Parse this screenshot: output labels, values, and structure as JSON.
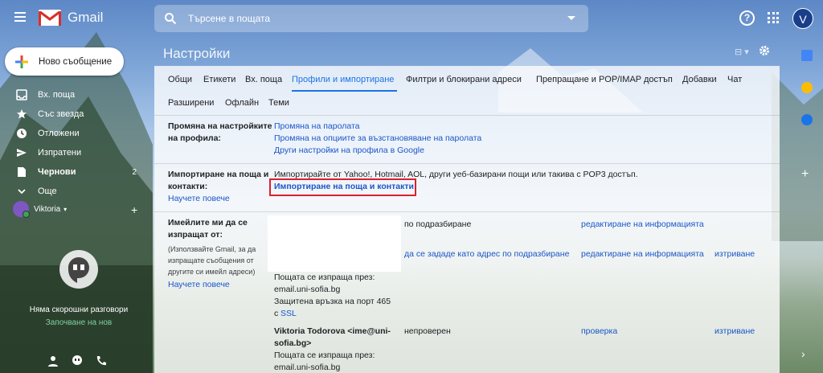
{
  "app": {
    "name": "Gmail",
    "user_initial": "V"
  },
  "search": {
    "placeholder": "Търсене в пощата"
  },
  "compose": {
    "label": "Ново съобщение"
  },
  "nav": [
    {
      "label": "Вх. поща",
      "icon": "inbox-icon",
      "bold": false,
      "count": ""
    },
    {
      "label": "Със звезда",
      "icon": "star-icon",
      "bold": false,
      "count": ""
    },
    {
      "label": "Отложени",
      "icon": "clock-icon",
      "bold": false,
      "count": ""
    },
    {
      "label": "Изпратени",
      "icon": "send-icon",
      "bold": false,
      "count": ""
    },
    {
      "label": "Чернови",
      "icon": "draft-icon",
      "bold": true,
      "count": "2"
    },
    {
      "label": "Още",
      "icon": "chevron-down-icon",
      "bold": false,
      "count": ""
    }
  ],
  "hangouts": {
    "user": "Viktoria",
    "no_chats": "Няма скорошни разговори",
    "start_new": "Започване на нов"
  },
  "settings": {
    "title": "Настройки",
    "tabs": [
      "Общи",
      "Етикети",
      "Вх. поща",
      "Профили и импортиране",
      "Филтри и блокирани адреси",
      "Препращане и POP/IMAP достъп",
      "Добавки",
      "Чат",
      "Разширени",
      "Офлайн",
      "Теми"
    ],
    "active_tab": "Профили и импортиране",
    "profile": {
      "label_1": "Промяна на настройките",
      "label_2": "на профила:",
      "links": [
        "Промяна на паролата",
        "Промяна на опциите за възстановяване на паролата",
        "Други настройки на профила в Google"
      ]
    },
    "import": {
      "label_1": "Импортиране на поща и",
      "label_2": "контакти:",
      "learn_more": "Научете повече",
      "description": "Импортирайте от Yahoo!, Hotmail, AOL, други уеб-базирани пощи или такива с POP3 достъп.",
      "action": "Импортиране на поща и контакти"
    },
    "send_as": {
      "label_1": "Имейлите ми да се",
      "label_2": "изпращат от:",
      "note_1": "(Използвайте Gmail, за да",
      "note_2": "изпращате съобщения от",
      "note_3": "другите си имейл адреси)",
      "learn_more": "Научете повече",
      "default": "по подразбиране",
      "edit_info": "редактиране на информацията",
      "make_default": "да се зададе като адрес по подразбиране",
      "delete": "изтриване",
      "sent_via": "Пощата се изпраща през:",
      "server": "email.uni-sofia.bg",
      "secure_1": "Защитена връзка на порт 465",
      "secure_2": "с",
      "ssl": "SSL",
      "entry2_name_1": "Viktoria Todorova <ime@uni-",
      "entry2_name_2": "sofia.bg>",
      "unverified": "непроверен",
      "verify": "проверка",
      "sent_via_2": "Пощата се изпраща през:",
      "server_2": "email.uni-sofia.bg"
    }
  }
}
